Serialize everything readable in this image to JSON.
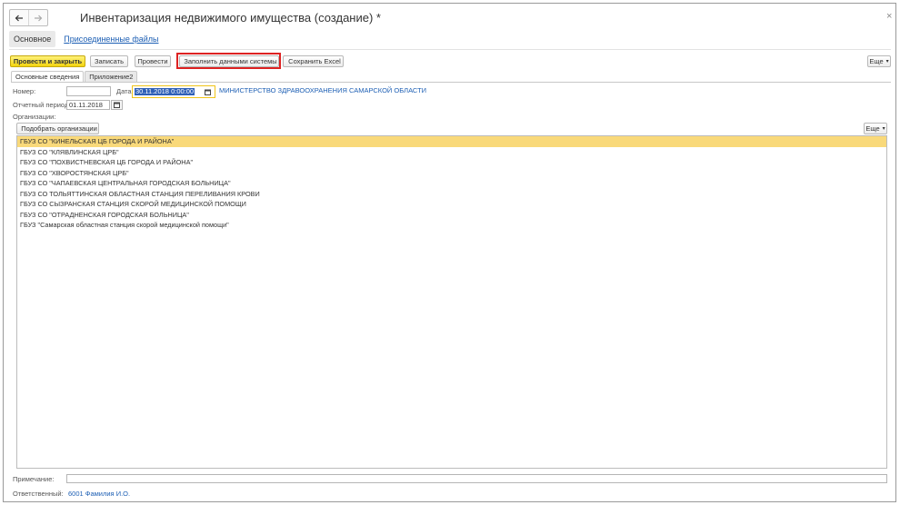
{
  "window": {
    "title": "Инвентаризация недвижимого имущества (создание) *",
    "close_glyph": "×"
  },
  "section_tabs": [
    {
      "label": "Основное",
      "active": true
    },
    {
      "label": "Присоединенные файлы",
      "active": false
    }
  ],
  "toolbar": {
    "post_and_close": "Провести и закрыть",
    "save": "Записать",
    "post": "Провести",
    "fill_system_data": "Заполнить данными системы",
    "save_excel": "Сохранить Excel",
    "more": "Еще",
    "more_caret": "▾"
  },
  "doc_tabs": [
    {
      "label": "Основные сведения",
      "active": true
    },
    {
      "label": "Приложение2",
      "active": false
    }
  ],
  "form": {
    "number_label": "Номер:",
    "number_value": "",
    "date_label": "Дата:",
    "date_value": "30.11.2018  0:00:00",
    "organization_link": "МИНИСТЕРСТВО ЗДРАВООХРАНЕНИЯ САМАРСКОЙ ОБЛАСТИ",
    "period_label": "Отчетный период:",
    "period_value": "01.11.2018",
    "organizations_label": "Организации:",
    "pick_orgs_button": "Подобрать организации",
    "list_more": "Еще",
    "note_label": "Примечание:",
    "note_value": "",
    "responsible_label": "Ответственный:",
    "responsible_value": "6001 Фамилия И.О."
  },
  "organizations": [
    "ГБУЗ СО \"КИНЕЛЬСКАЯ ЦБ ГОРОДА И РАЙОНА\"",
    "ГБУЗ СО \"КЛЯВЛИНСКАЯ ЦРБ\"",
    "ГБУЗ СО \"ПОХВИСТНЕВСКАЯ ЦБ ГОРОДА И РАЙОНА\"",
    "ГБУЗ СО \"ХВОРОСТЯНСКАЯ ЦРБ\"",
    "ГБУЗ СО \"ЧАПАЕВСКАЯ ЦЕНТРАЛЬНАЯ ГОРОДСКАЯ БОЛЬНИЦА\"",
    "ГБУЗ СО ТОЛЬЯТТИНСКАЯ ОБЛАСТНАЯ СТАНЦИЯ ПЕРЕЛИВАНИЯ КРОВИ",
    "ГБУЗ СО СЫЗРАНСКАЯ СТАНЦИЯ СКОРОЙ МЕДИЦИНСКОЙ ПОМОЩИ",
    "ГБУЗ СО \"ОТРАДНЕНСКАЯ ГОРОДСКАЯ БОЛЬНИЦА\"",
    "ГБУЗ \"Самарская областная станция скорой медицинской помощи\""
  ],
  "colors": {
    "accent_yellow": "#f3d40e",
    "highlight_red": "#dd2222",
    "link_blue": "#1d5fb4",
    "selected_row": "#f9d97a"
  }
}
